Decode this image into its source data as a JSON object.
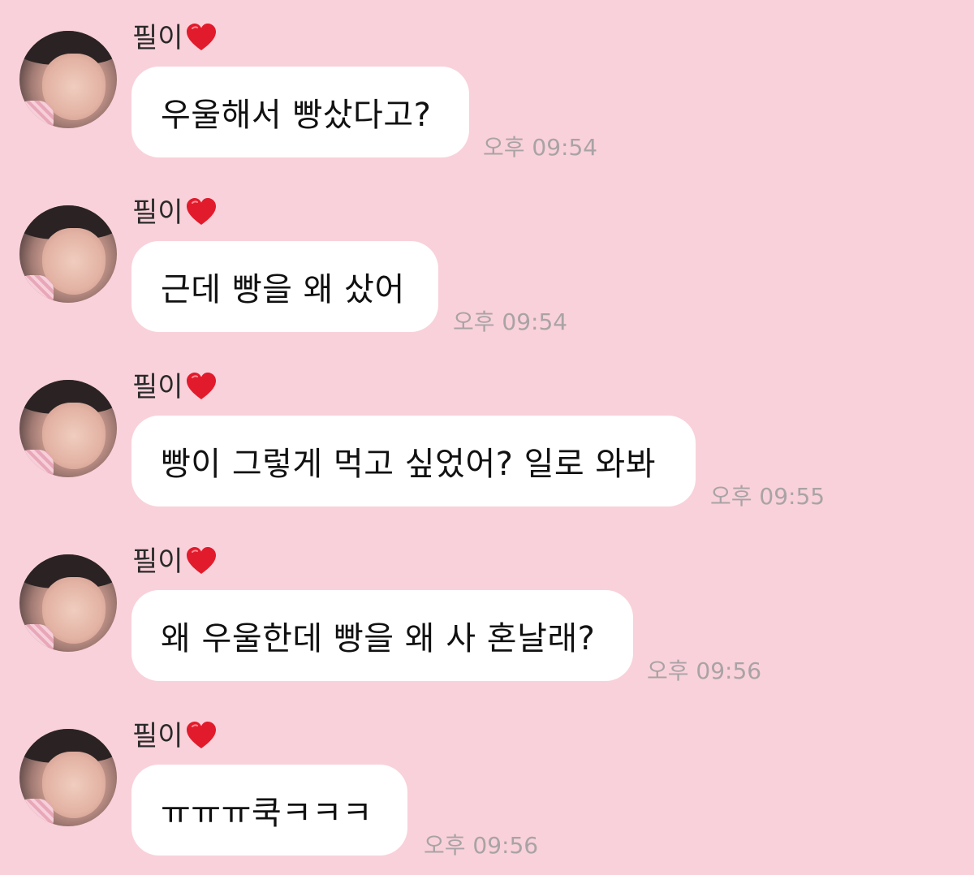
{
  "messages": [
    {
      "sender": "필이",
      "text": "우울해서 빵샀다고?",
      "time": "오후 09:54"
    },
    {
      "sender": "필이",
      "text": "근데 빵을 왜 샀어",
      "time": "오후 09:54"
    },
    {
      "sender": "필이",
      "text": "빵이 그렇게 먹고 싶었어? 일로 와봐",
      "time": "오후 09:55"
    },
    {
      "sender": "필이",
      "text": "왜 우울한데 빵을 왜 사 혼날래?",
      "time": "오후 09:56"
    },
    {
      "sender": "필이",
      "text": "ㅠㅠㅠ쿡ㅋㅋㅋ",
      "time": "오후 09:56"
    }
  ],
  "icons": {
    "heart": "heart-icon"
  },
  "colors": {
    "background": "#f9d1da",
    "bubble": "#ffffff",
    "heart": "#e21b2c",
    "time": "#a9a3a5"
  }
}
